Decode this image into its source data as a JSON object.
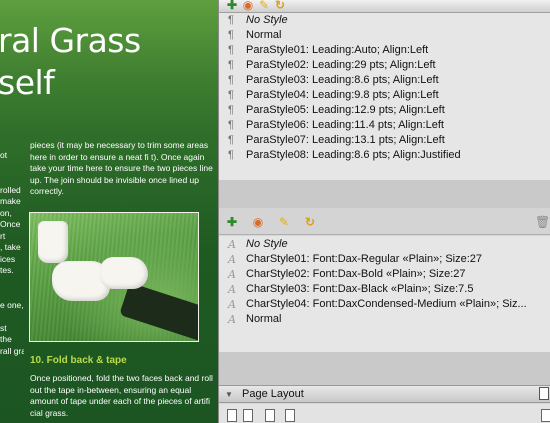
{
  "document": {
    "heading_lines": [
      "ral Grass",
      "self"
    ],
    "left_column_fragments": [
      "ot",
      "",
      "",
      "rolled",
      "make",
      "on,",
      "Once",
      "rt",
      ", take",
      "ices",
      "tes.",
      "",
      "",
      "e one,",
      "",
      "st",
      "the",
      "rall grass"
    ],
    "paragraph_top": "pieces (it may be necessary to trim some areas here in order to ensure a neat fi t). Once again take your time here to ensure the two pieces line up. The join should be invisible once lined up correctly.",
    "subheading": "10. Fold back & tape",
    "paragraph_bottom": "Once positioned, fold the two faces back and roll out the tape in-between, ensuring an equal amount of tape under each of the pieces of artifi cial grass."
  },
  "paragraph_styles": {
    "toolbar_icons": [
      "new-style-icon",
      "load-styles-icon",
      "edit-style-icon",
      "redo-icon"
    ],
    "items": [
      {
        "label": "No Style",
        "italic": true
      },
      {
        "label": "Normal",
        "italic": false
      },
      {
        "label": "ParaStyle01: Leading:Auto; Align:Left",
        "italic": false
      },
      {
        "label": "ParaStyle02: Leading:29 pts; Align:Left",
        "italic": false
      },
      {
        "label": "ParaStyle03: Leading:8.6 pts; Align:Left",
        "italic": false
      },
      {
        "label": "ParaStyle04: Leading:9.8 pts; Align:Left",
        "italic": false
      },
      {
        "label": "ParaStyle05: Leading:12.9 pts; Align:Left",
        "italic": false
      },
      {
        "label": "ParaStyle06: Leading:11.4 pts; Align:Left",
        "italic": false
      },
      {
        "label": "ParaStyle07: Leading:13.1 pts; Align:Left",
        "italic": false
      },
      {
        "label": "ParaStyle08: Leading:8.6 pts; Align:Justified",
        "italic": false
      }
    ]
  },
  "character_styles": {
    "toolbar_icons": [
      "new-style-icon",
      "load-styles-icon",
      "edit-style-icon",
      "redo-icon",
      "trash-icon"
    ],
    "items": [
      {
        "label": "No Style",
        "italic": true
      },
      {
        "label": "CharStyle01: Font:Dax-Regular «Plain»; Size:27",
        "italic": false
      },
      {
        "label": "CharStyle02: Font:Dax-Bold «Plain»; Size:27",
        "italic": false
      },
      {
        "label": "CharStyle03: Font:Dax-Black «Plain»; Size:7.5",
        "italic": false
      },
      {
        "label": "CharStyle04: Font:DaxCondensed-Medium «Plain»; Siz...",
        "italic": false
      },
      {
        "label": "Normal",
        "italic": false
      }
    ]
  },
  "page_layout": {
    "title": "Page Layout"
  },
  "glyphs": {
    "paragraph": "¶",
    "character": "A"
  },
  "colors": {
    "subheading": "#b9dc4a",
    "panel_list_bg": "#e6e6e6",
    "panel_bg": "#d6d6d6"
  }
}
